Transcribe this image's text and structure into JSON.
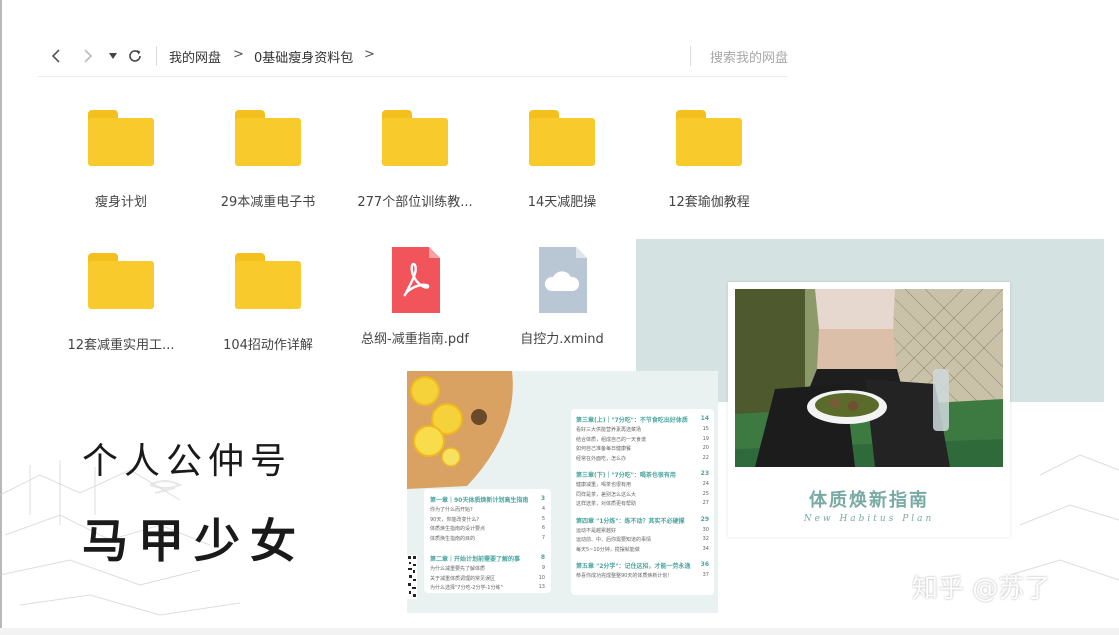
{
  "toolbar": {
    "back_icon": "chevron-left-icon",
    "forward_icon": "chevron-right-icon",
    "dropdown_icon": "caret-down-icon",
    "refresh_icon": "refresh-icon",
    "breadcrumb": [
      {
        "label": "我的网盘"
      },
      {
        "label": "0基础瘦身资料包"
      }
    ],
    "separator": ">",
    "search_placeholder": "搜索我的网盘"
  },
  "files": [
    {
      "name": "瘦身计划",
      "type": "folder"
    },
    {
      "name": "29本减重电子书",
      "type": "folder"
    },
    {
      "name": "277个部位训练教...",
      "type": "folder"
    },
    {
      "name": "14天减肥操",
      "type": "folder"
    },
    {
      "name": "12套瑜伽教程",
      "type": "folder"
    },
    {
      "name": "12套减重实用工...",
      "type": "folder"
    },
    {
      "name": "104招动作详解",
      "type": "folder"
    },
    {
      "name": "总纲-减重指南.pdf",
      "type": "pdf"
    },
    {
      "name": "自控力.xmind",
      "type": "xmind"
    }
  ],
  "colors": {
    "folder": "#f8ca2c",
    "pdf": "#f2545b",
    "xmind": "#b9c6d3",
    "teal_panel": "#d4e2e1",
    "guide_title": "#79aaa5",
    "toc_heading": "#4aa5a0"
  },
  "toc": {
    "left": [
      {
        "title": "第一章｜90天体质焕新计划高生指南",
        "page": "3",
        "items": [
          {
            "t": "你为了什么而开始?",
            "p": "4"
          },
          {
            "t": "90天，你能改变什么?",
            "p": "5"
          },
          {
            "t": "体质焕生指南的设计要点",
            "p": "6"
          },
          {
            "t": "体质焕生指南的目的",
            "p": "7"
          }
        ]
      },
      {
        "title": "第二章｜开始计划前需要了解的事",
        "page": "8",
        "items": [
          {
            "t": "为什么减重要先了解体质",
            "p": "9"
          },
          {
            "t": "关于减重体质调理的常见误区",
            "p": "10"
          },
          {
            "t": "为什么选择\"7分吃-2分学-1分练\"",
            "p": "13"
          }
        ]
      }
    ],
    "right": [
      {
        "title": "第三章(上)｜\"7分吃\"：不节食吃出好体质",
        "page": "14",
        "items": [
          {
            "t": "看好三大供能营养素再选菜场",
            "p": "15"
          },
          {
            "t": "结合体质，组成自己的一天食谱",
            "p": "19"
          },
          {
            "t": "如何自己准备每日健康餐",
            "p": "20"
          },
          {
            "t": "经常在外面吃，怎么办",
            "p": "22"
          }
        ]
      },
      {
        "title": "第三章(下)｜\"7分吃\"：喝茶也很有用",
        "page": "23",
        "items": [
          {
            "t": "健康减重，喝茶也很有用",
            "p": "24"
          },
          {
            "t": "同样是茶，差别怎么这么大",
            "p": "25"
          },
          {
            "t": "这样选茶，对体质更有帮助",
            "p": "27"
          }
        ]
      },
      {
        "title": "第四章 \"1分练\"：练不动？其实不必硬撑",
        "page": "29",
        "items": [
          {
            "t": "运动不是越累越好",
            "p": "30"
          },
          {
            "t": "运动前、中、后你需要知道的事情",
            "p": "32"
          },
          {
            "t": "每天5~10分钟，搅摆就能做",
            "p": "34"
          }
        ]
      },
      {
        "title": "第五章 \"2分学\"：记住这招，才能一劳永逸",
        "page": "36",
        "items": [
          {
            "t": "恭喜你成功完成整整90天的体质焕新计划!",
            "p": "37"
          }
        ]
      }
    ]
  },
  "guide": {
    "title": "体质焕新指南",
    "subtitle": "New Habitus Plan"
  },
  "calligraphy": {
    "line1": "个人公仲号",
    "line2": "马甲少女"
  },
  "watermark": "知乎 @苏了"
}
